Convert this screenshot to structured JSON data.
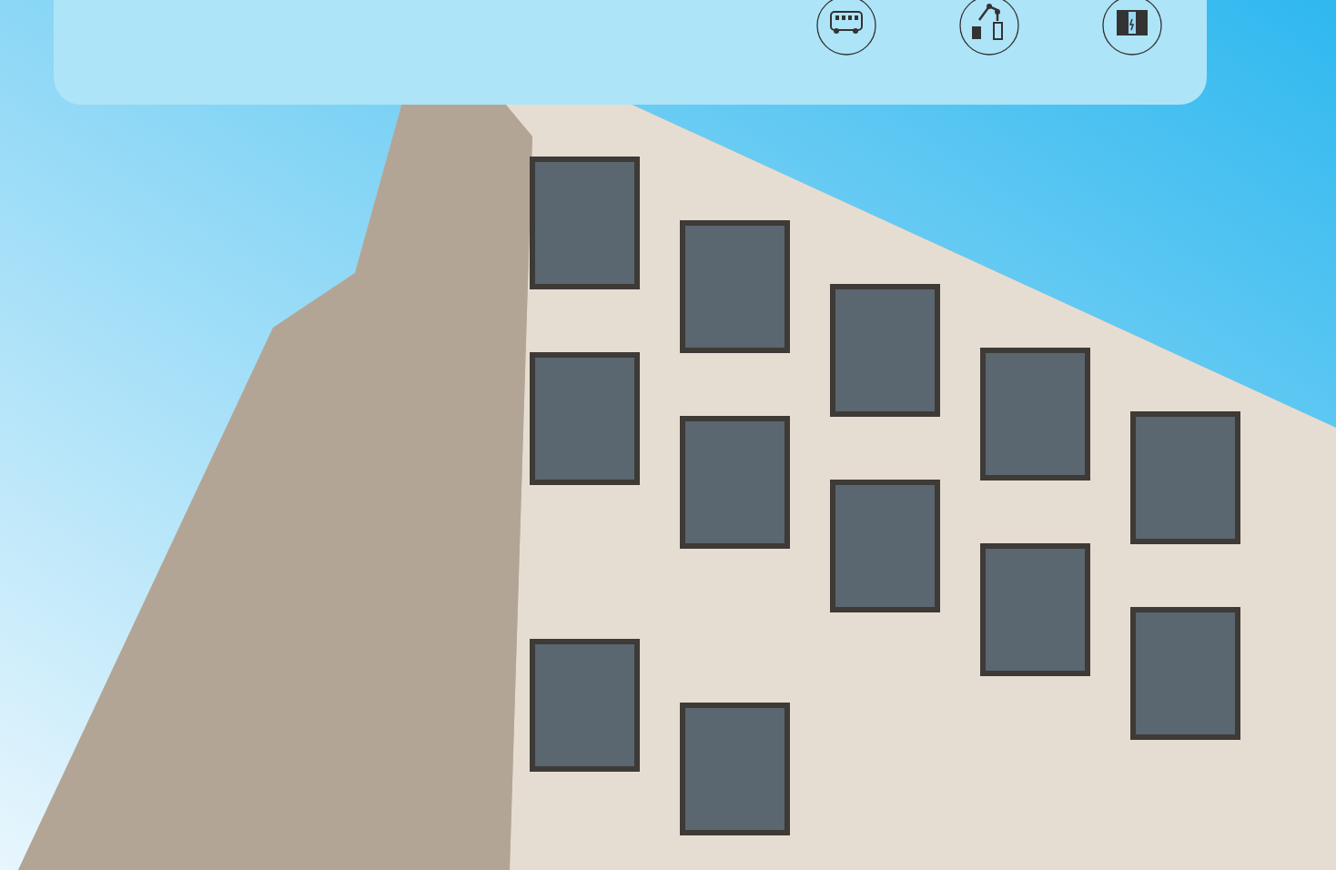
{
  "feature_card": {
    "icons": [
      {
        "kind": "bus"
      },
      {
        "kind": "robot-arm"
      },
      {
        "kind": "power-cabinet"
      }
    ]
  },
  "photo": {
    "kind": "building"
  }
}
